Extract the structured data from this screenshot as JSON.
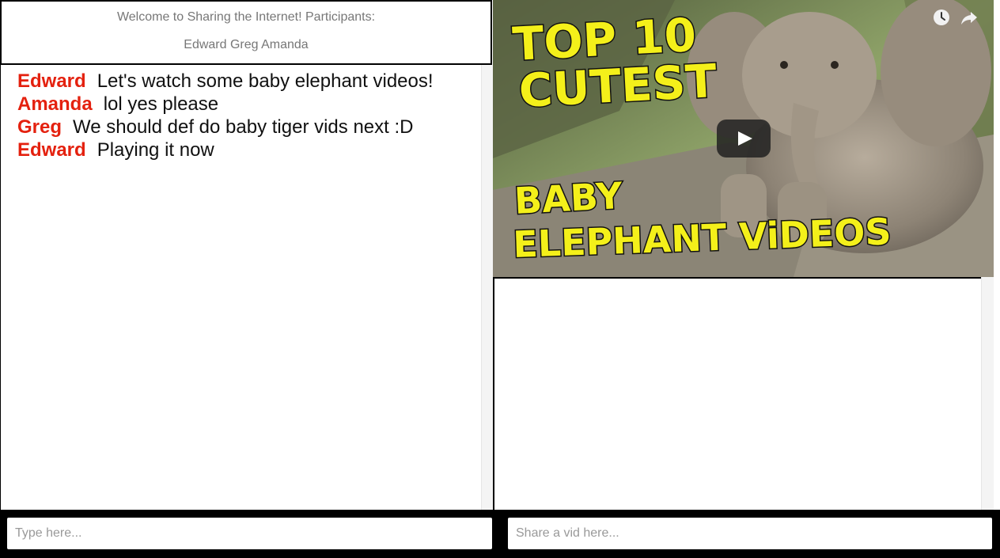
{
  "welcome": {
    "title": "Welcome to Sharing the Internet! Participants:",
    "participants": "Edward Greg Amanda"
  },
  "chat": {
    "messages": [
      {
        "sender": "Edward",
        "text": "Let's watch some baby elephant videos!"
      },
      {
        "sender": "Amanda",
        "text": "lol yes please"
      },
      {
        "sender": "Greg",
        "text": "We should def do baby tiger vids next :D"
      },
      {
        "sender": "Edward",
        "text": "Playing it now"
      }
    ],
    "sender_color": "#e4210f"
  },
  "video": {
    "thumbnail_text_top": [
      "TOP 10",
      "CUTEST"
    ],
    "thumbnail_text_bottom": [
      "BABY",
      "ELEPHANT VIDEOS"
    ],
    "icons": [
      "clock-icon",
      "share-icon",
      "play-icon"
    ]
  },
  "inputs": {
    "chat_placeholder": "Type here...",
    "vid_placeholder": "Share a vid here..."
  }
}
